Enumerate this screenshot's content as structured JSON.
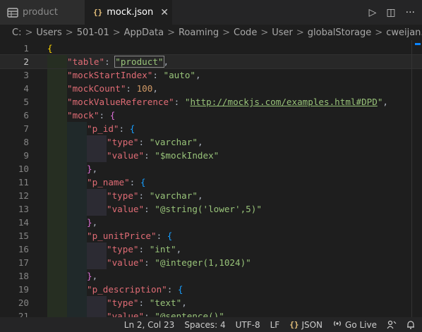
{
  "tabs": [
    {
      "label": "product",
      "icon": "table-icon",
      "active": false
    },
    {
      "label": "mock.json",
      "icon": "json-braces-icon",
      "icon_text": "{}",
      "active": true,
      "close": "✕"
    }
  ],
  "actions": [
    {
      "name": "run-icon",
      "glyph": "▷"
    },
    {
      "name": "split-editor-icon",
      "glyph": "◫"
    },
    {
      "name": "more-actions-icon",
      "glyph": "···"
    }
  ],
  "breadcrumbs": [
    "C:",
    "Users",
    "501-01",
    "AppData",
    "Roaming",
    "Code",
    "User",
    "globalStorage",
    "cweijan.vscode-mysql-c"
  ],
  "breadcrumb_sep": ">",
  "editor": {
    "lines": [
      {
        "num": "1",
        "text": "{"
      },
      {
        "num": "2",
        "text": "\"table\": \"product\","
      },
      {
        "num": "3",
        "text": "\"mockStartIndex\": \"auto\","
      },
      {
        "num": "4",
        "text": "\"mockCount\": 100,"
      },
      {
        "num": "5",
        "text": "\"mockValueReference\": \"http://mockjs.com/examples.html#DPD\","
      },
      {
        "num": "6",
        "text": "\"mock\": {"
      },
      {
        "num": "7",
        "text": "\"p_id\": {"
      },
      {
        "num": "8",
        "text": "\"type\": \"varchar\","
      },
      {
        "num": "9",
        "text": "\"value\": \"$mockIndex\""
      },
      {
        "num": "10",
        "text": "},"
      },
      {
        "num": "11",
        "text": "\"p_name\": {"
      },
      {
        "num": "12",
        "text": "\"type\": \"varchar\","
      },
      {
        "num": "13",
        "text": "\"value\": \"@string('lower',5)\""
      },
      {
        "num": "14",
        "text": "},"
      },
      {
        "num": "15",
        "text": "\"p_unitPrice\": {"
      },
      {
        "num": "16",
        "text": "\"type\": \"int\","
      },
      {
        "num": "17",
        "text": "\"value\": \"@integer(1,1024)\""
      },
      {
        "num": "18",
        "text": "},"
      },
      {
        "num": "19",
        "text": "\"p_description\": {"
      },
      {
        "num": "20",
        "text": "\"type\": \"text\","
      },
      {
        "num": "21",
        "text": "\"value\": \"@sentence()\""
      }
    ]
  },
  "status_bar": {
    "position": "Ln 2, Col 23",
    "indent": "Spaces: 4",
    "encoding": "UTF-8",
    "eol": "LF",
    "language": "JSON",
    "language_icon": "{}",
    "go_live": "Go Live",
    "go_live_icon": "broadcast-icon",
    "feedback_icon": "feedback-icon",
    "notifications_icon": "bell-icon"
  },
  "colors": {
    "key": "#e06c75",
    "string": "#98c379",
    "number": "#d19a66",
    "bracket_level1": "#ffd700",
    "bracket_level2": "#da70d6",
    "bracket_level3": "#179fff"
  }
}
